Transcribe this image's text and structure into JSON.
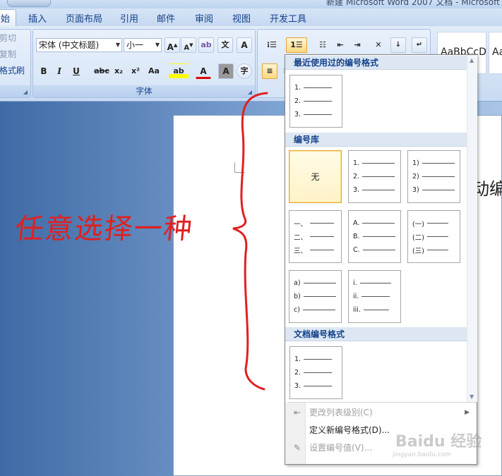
{
  "window": {
    "title": "新建 Microsoft Word 2007 文档 - Microsoft"
  },
  "tabs": [
    {
      "label": "始",
      "active": true
    },
    {
      "label": "插入"
    },
    {
      "label": "页面布局"
    },
    {
      "label": "引用"
    },
    {
      "label": "邮件"
    },
    {
      "label": "审阅"
    },
    {
      "label": "视图"
    },
    {
      "label": "开发工具"
    }
  ],
  "clipboard": {
    "cut": "剪切",
    "copy": "复制",
    "format_painter": "格式刷"
  },
  "font_group": {
    "font_name": "宋体 (中文标题)",
    "font_size": "小一",
    "label": "字体",
    "bold": "B",
    "italic": "I",
    "underline": "U",
    "strike": "abc",
    "subscript": "x₂",
    "superscript": "x²",
    "case": "Aa",
    "grow": "A",
    "shrink": "A",
    "clear": "ab",
    "phonetic": "文",
    "border": "A",
    "highlight": "ab",
    "font_color": "A",
    "shading": "A",
    "enclose": "字"
  },
  "styles": {
    "sample1": "AaBbCcD",
    "sample2": "Aa"
  },
  "document": {
    "visible_text": "动编"
  },
  "annotation": "任意选择一种",
  "numbering_panel": {
    "recent_header": "最近使用过的编号格式",
    "library_header": "编号库",
    "document_header": "文档编号格式",
    "none_label": "无",
    "recent": [
      [
        "1.",
        "2.",
        "3."
      ]
    ],
    "library": [
      [
        "1.",
        "2.",
        "3."
      ],
      [
        "1)",
        "2)",
        "3)"
      ],
      [
        "一、",
        "二、",
        "三、"
      ],
      [
        "A.",
        "B.",
        "C."
      ],
      [
        "(一)",
        "(二)",
        "(三)"
      ],
      [
        "a)",
        "b)",
        "c)"
      ],
      [
        "i.",
        "ii.",
        "iii."
      ]
    ],
    "document_formats": [
      [
        "1.",
        "2.",
        "3."
      ]
    ],
    "menu": {
      "change_level": "更改列表级别(C)",
      "define_new": "定义新编号格式(D)...",
      "set_value": "设置编号值(V)..."
    }
  },
  "watermark": {
    "logo": "Baidu 经验",
    "url": "jingyan.baidu.com"
  },
  "colors": {
    "annotation_red": "#e02020",
    "selected_tile": "#e5a33c",
    "ribbon_text": "#15428b"
  }
}
